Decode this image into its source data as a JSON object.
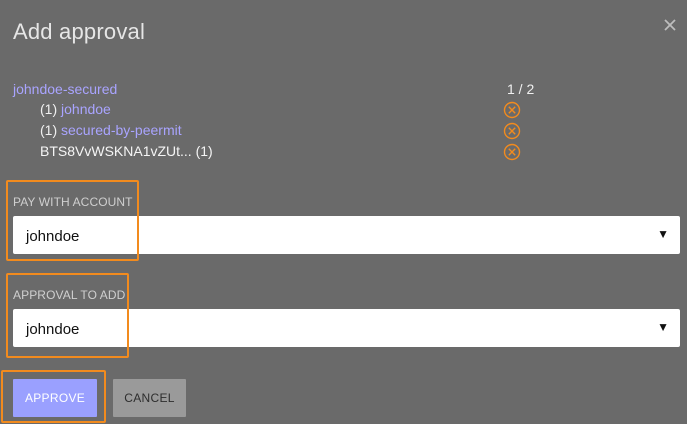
{
  "dialog": {
    "title": "Add approval",
    "close_icon": "close-icon"
  },
  "authority": {
    "account": "johndoe-secured",
    "threshold": "1 / 2",
    "rows": [
      {
        "weight": "(1)",
        "name": "johndoe",
        "type": "account"
      },
      {
        "weight": "(1)",
        "name": "secured-by-peermit",
        "type": "account"
      },
      {
        "key": "BTS8VvWSKNA1vZUt...",
        "weight": "(1)",
        "type": "key"
      }
    ],
    "remove_icon": "remove-circle-icon"
  },
  "pay_with": {
    "label": "PAY WITH ACCOUNT",
    "selected": "johndoe"
  },
  "approval_to_add": {
    "label": "APPROVAL TO ADD",
    "selected": "johndoe"
  },
  "actions": {
    "approve_label": "APPROVE",
    "cancel_label": "CANCEL"
  },
  "colors": {
    "background": "#6a6a6a",
    "link": "#a9a4ff",
    "highlight": "#f28b1e",
    "remove": "#f28b1e",
    "approve": "#9aa0ff",
    "cancel": "#9a9a9a"
  }
}
